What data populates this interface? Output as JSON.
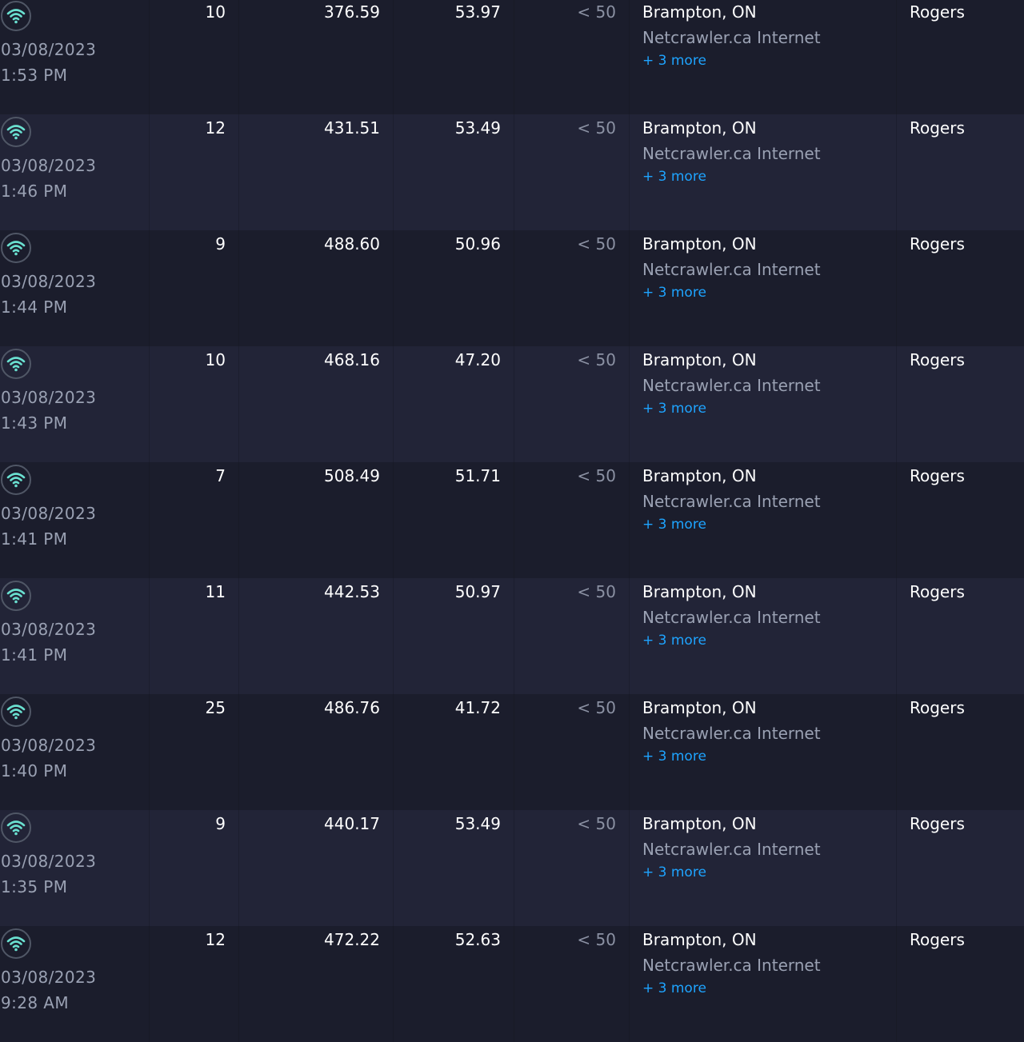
{
  "accent_color": "#6ae0d0",
  "link_color": "#1ea4ff",
  "connection_icon": "wifi-icon",
  "results": [
    {
      "date": "03/08/2023",
      "time": "1:53 PM",
      "ping": "10",
      "download": "376.59",
      "upload": "53.97",
      "distance": "< 50",
      "server_location": "Brampton, ON",
      "server_sponsor": "Netcrawler.ca Internet",
      "more_servers": "+ 3 more",
      "isp": "Rogers"
    },
    {
      "date": "03/08/2023",
      "time": "1:46 PM",
      "ping": "12",
      "download": "431.51",
      "upload": "53.49",
      "distance": "< 50",
      "server_location": "Brampton, ON",
      "server_sponsor": "Netcrawler.ca Internet",
      "more_servers": "+ 3 more",
      "isp": "Rogers"
    },
    {
      "date": "03/08/2023",
      "time": "1:44 PM",
      "ping": "9",
      "download": "488.60",
      "upload": "50.96",
      "distance": "< 50",
      "server_location": "Brampton, ON",
      "server_sponsor": "Netcrawler.ca Internet",
      "more_servers": "+ 3 more",
      "isp": "Rogers"
    },
    {
      "date": "03/08/2023",
      "time": "1:43 PM",
      "ping": "10",
      "download": "468.16",
      "upload": "47.20",
      "distance": "< 50",
      "server_location": "Brampton, ON",
      "server_sponsor": "Netcrawler.ca Internet",
      "more_servers": "+ 3 more",
      "isp": "Rogers"
    },
    {
      "date": "03/08/2023",
      "time": "1:41 PM",
      "ping": "7",
      "download": "508.49",
      "upload": "51.71",
      "distance": "< 50",
      "server_location": "Brampton, ON",
      "server_sponsor": "Netcrawler.ca Internet",
      "more_servers": "+ 3 more",
      "isp": "Rogers"
    },
    {
      "date": "03/08/2023",
      "time": "1:41 PM",
      "ping": "11",
      "download": "442.53",
      "upload": "50.97",
      "distance": "< 50",
      "server_location": "Brampton, ON",
      "server_sponsor": "Netcrawler.ca Internet",
      "more_servers": "+ 3 more",
      "isp": "Rogers"
    },
    {
      "date": "03/08/2023",
      "time": "1:40 PM",
      "ping": "25",
      "download": "486.76",
      "upload": "41.72",
      "distance": "< 50",
      "server_location": "Brampton, ON",
      "server_sponsor": "Netcrawler.ca Internet",
      "more_servers": "+ 3 more",
      "isp": "Rogers"
    },
    {
      "date": "03/08/2023",
      "time": "1:35 PM",
      "ping": "9",
      "download": "440.17",
      "upload": "53.49",
      "distance": "< 50",
      "server_location": "Brampton, ON",
      "server_sponsor": "Netcrawler.ca Internet",
      "more_servers": "+ 3 more",
      "isp": "Rogers"
    },
    {
      "date": "03/08/2023",
      "time": "9:28 AM",
      "ping": "12",
      "download": "472.22",
      "upload": "52.63",
      "distance": "< 50",
      "server_location": "Brampton, ON",
      "server_sponsor": "Netcrawler.ca Internet",
      "more_servers": "+ 3 more",
      "isp": "Rogers"
    }
  ]
}
